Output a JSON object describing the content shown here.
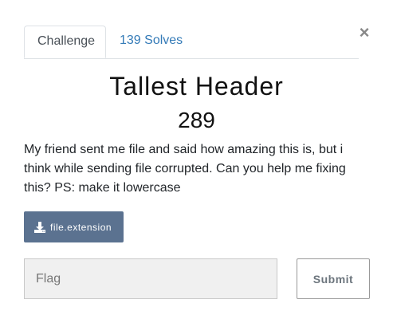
{
  "modal": {
    "close_glyph": "×",
    "tabs": [
      {
        "label": "Challenge",
        "active": true
      },
      {
        "label": "139 Solves",
        "active": false
      }
    ],
    "challenge": {
      "title": "Tallest Header",
      "points": "289",
      "description": "My friend sent me file and said how amazing this is, but i think while sending file corrupted. Can you help me fixing this? PS: make it lowercase",
      "file_label": "file.extension",
      "file_icon": "download-icon"
    },
    "form": {
      "flag_placeholder": "Flag",
      "flag_value": "",
      "submit_label": "Submit"
    },
    "colors": {
      "file_button_bg": "#5b7290",
      "link": "#337ab7",
      "input_bg": "#f0f0f0"
    }
  }
}
